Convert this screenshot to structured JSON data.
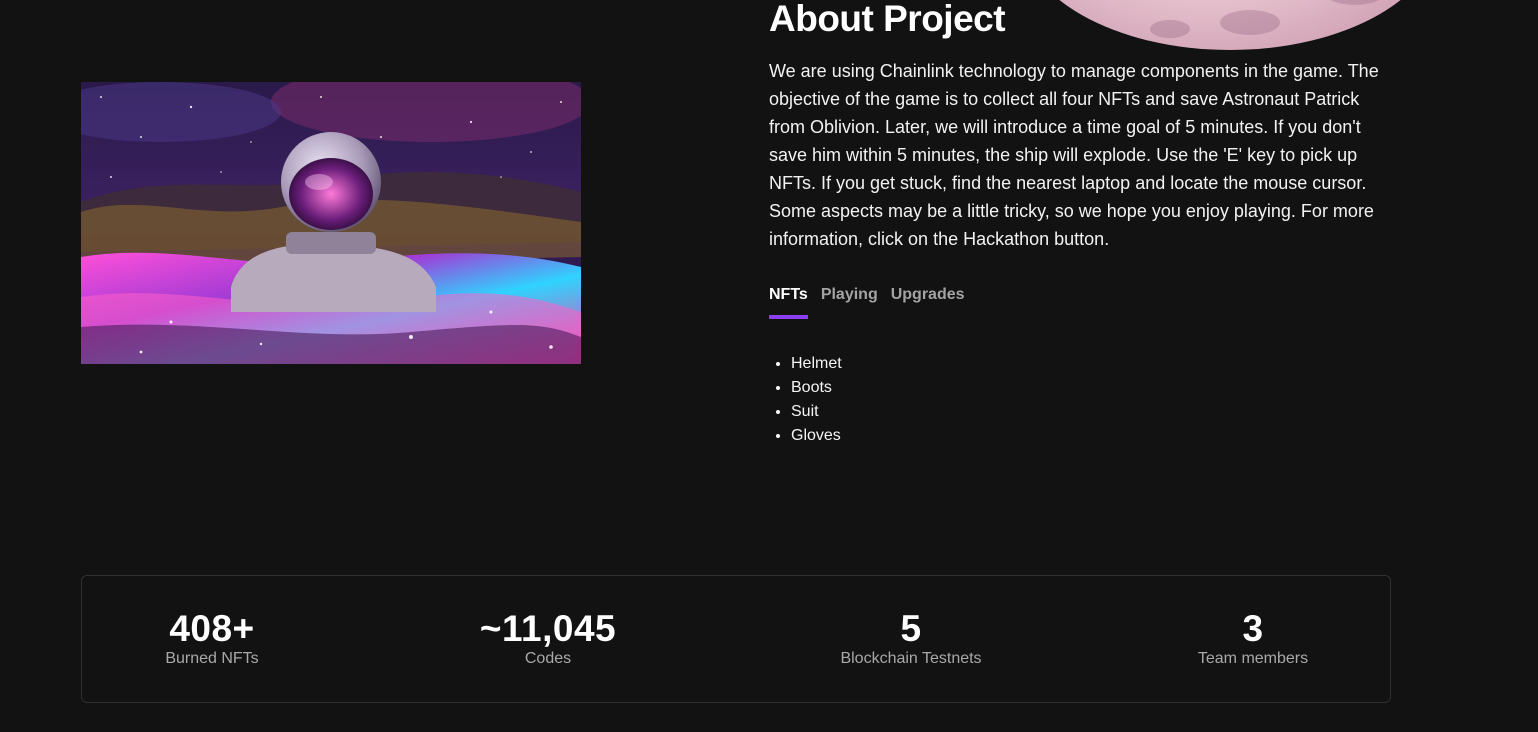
{
  "about": {
    "title": "About Project",
    "description": "We are using Chainlink technology to manage components in the game. The objective of the game is to collect all four NFTs and save Astronaut Patrick from Oblivion. Later, we will introduce a time goal of 5 minutes. If you don't save him within 5 minutes, the ship will explode. Use the 'E' key to pick up NFTs. If you get stuck, find the nearest laptop and locate the mouse cursor. Some aspects may be a little tricky, so we hope you enjoy playing. For more information, click on the Hackathon button."
  },
  "tabs": [
    {
      "label": "NFTs",
      "active": true
    },
    {
      "label": "Playing",
      "active": false
    },
    {
      "label": "Upgrades",
      "active": false
    }
  ],
  "nft_items": [
    "Helmet",
    "Boots",
    "Suit",
    "Gloves"
  ],
  "stats": [
    {
      "value": "408+",
      "label": "Burned NFTs"
    },
    {
      "value": "~11,045",
      "label": "Codes"
    },
    {
      "value": "5",
      "label": "Blockchain Testnets"
    },
    {
      "value": "3",
      "label": "Team members"
    }
  ],
  "colors": {
    "background": "#121212",
    "accent": "#8b3ff0",
    "muted_text": "#a3a3a3"
  },
  "images": {
    "hero": "astronaut-in-cosmic-ocean-illustration",
    "planet": "pink-moon-decoration"
  }
}
